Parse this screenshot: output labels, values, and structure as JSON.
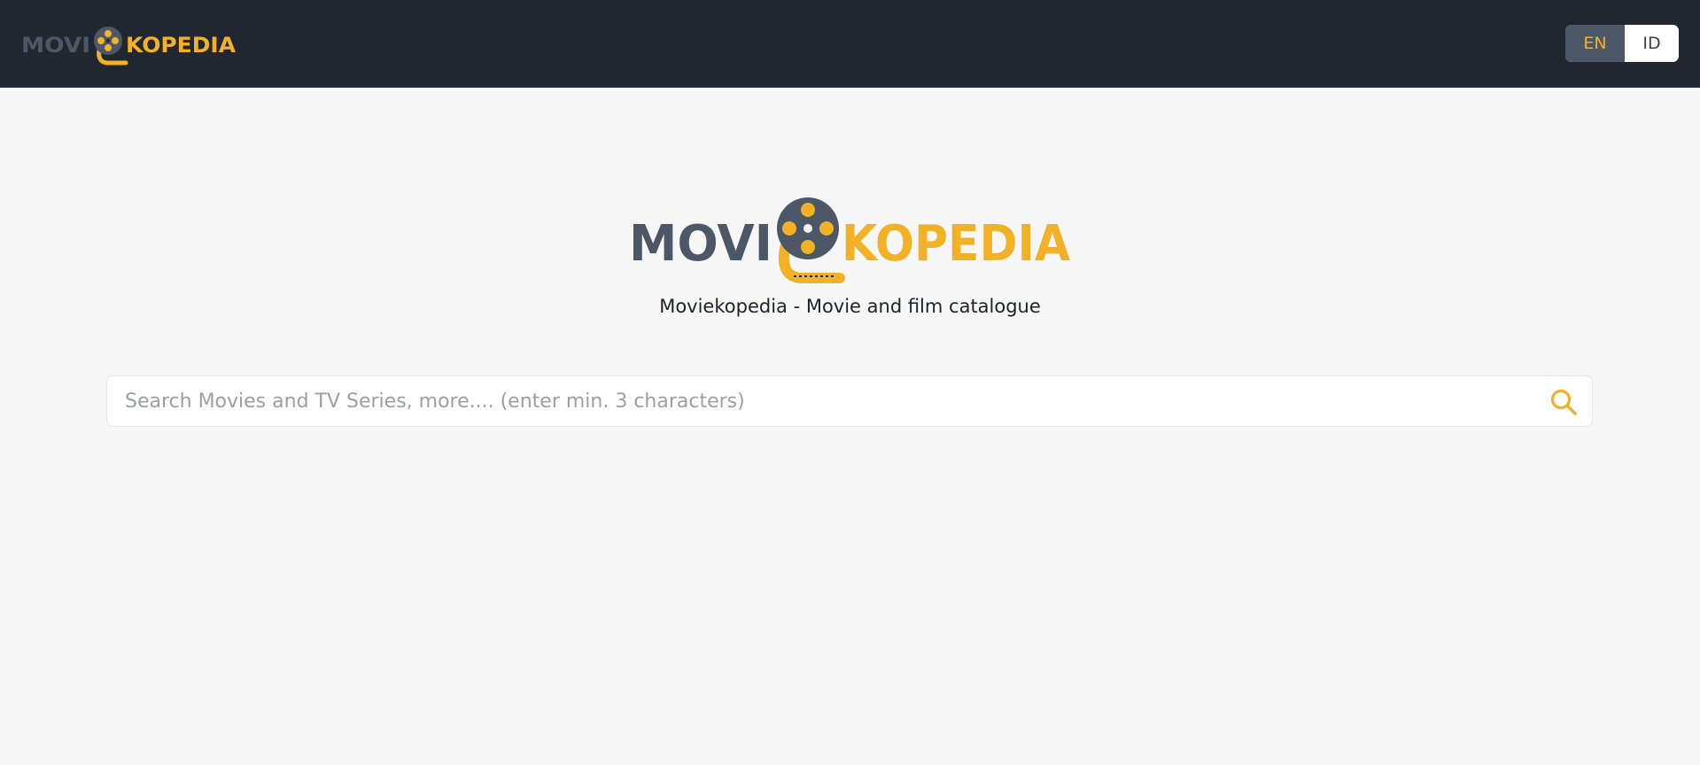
{
  "header": {
    "logo": {
      "text_left": "MOVI",
      "text_right": "KOPEDIA",
      "icon": "film-reel-icon"
    },
    "language_switcher": {
      "options": [
        {
          "label": "EN",
          "active": true
        },
        {
          "label": "ID",
          "active": false
        }
      ]
    }
  },
  "hero": {
    "logo": {
      "text_left": "MOVI",
      "text_right": "KOPEDIA",
      "icon": "film-reel-icon"
    },
    "tagline": "Moviekopedia - Movie and film catalogue"
  },
  "search": {
    "placeholder": "Search Movies and TV Series, more.... (enter min. 3 characters)",
    "value": "",
    "icon": "search-icon"
  },
  "colors": {
    "header_bg": "#212731",
    "page_bg": "#f7f7f8",
    "accent": "#f3b126",
    "slate": "#4c5867"
  }
}
